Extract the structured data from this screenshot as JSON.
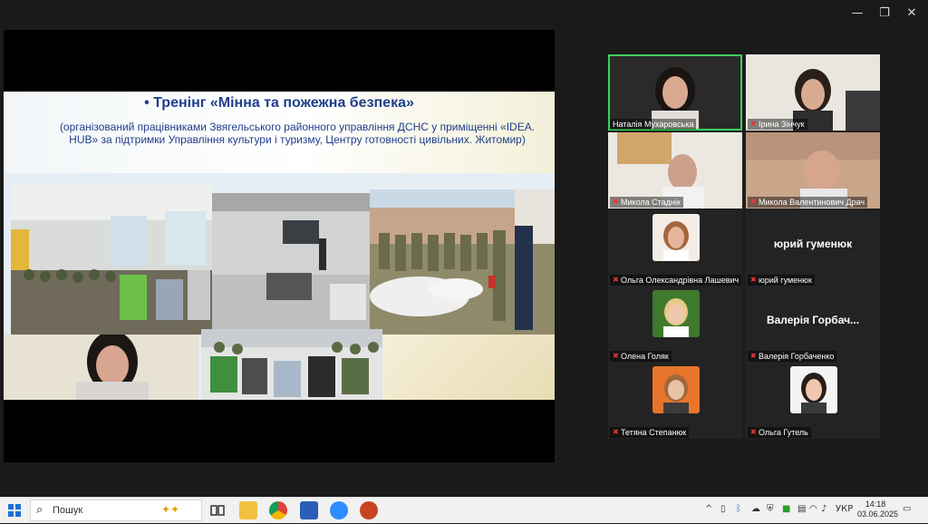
{
  "window": {
    "minimize_glyph": "—",
    "restore_glyph": "❐",
    "close_glyph": "✕"
  },
  "slide": {
    "title": "•  Тренінг «Мінна та пожежна безпека»",
    "subtitle": "(організований працівниками Звягельського районного управління ДСНС у приміщенні «IDEA. HUB» за підтримки Управління культури і туризму, Центру готовності цивільних. Житомир)"
  },
  "participants": [
    {
      "name": "Наталія Мухаровська",
      "muted": false,
      "active": true,
      "display": "video"
    },
    {
      "name": "Ірина Зінчук",
      "muted": true,
      "active": false,
      "display": "video"
    },
    {
      "name": "Микола Стаднік",
      "muted": true,
      "active": false,
      "display": "video"
    },
    {
      "name": "Микола Валентинович Драч",
      "muted": true,
      "active": false,
      "display": "video"
    },
    {
      "name": "Ольга Олександрівна Лашевич",
      "muted": true,
      "active": false,
      "display": "avatar"
    },
    {
      "name": "юрий гуменюк",
      "muted": true,
      "active": false,
      "display": "name",
      "big_name": "юрий гуменюк"
    },
    {
      "name": "Олена Голяк",
      "muted": true,
      "active": false,
      "display": "avatar"
    },
    {
      "name": "Валерія Горбаченко",
      "muted": true,
      "active": false,
      "display": "name",
      "big_name": "Валерія Горбач..."
    },
    {
      "name": "Тетяна Степанюк",
      "muted": true,
      "active": false,
      "display": "avatar"
    },
    {
      "name": "Ольга Гутель",
      "muted": true,
      "active": false,
      "display": "avatar"
    }
  ],
  "taskbar": {
    "search_label": "Пошук",
    "language": "УКР",
    "time": "14:18",
    "date": "03.06.2025",
    "pinned_apps": [
      "file-explorer",
      "chrome",
      "word",
      "zoom",
      "powerpoint"
    ]
  },
  "colors": {
    "accent_active_speaker": "#3bd15a",
    "muted_icon": "#e0393b",
    "slide_title": "#1f3e8a"
  }
}
